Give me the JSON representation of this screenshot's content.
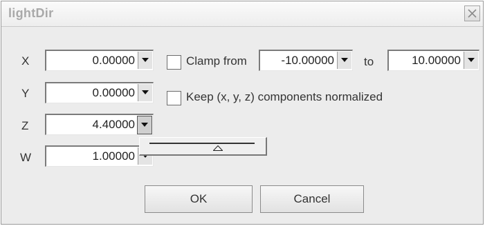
{
  "window": {
    "title": "lightDir",
    "close_icon": "close-x-icon"
  },
  "fields": [
    {
      "label": "X",
      "value": "0.00000"
    },
    {
      "label": "Y",
      "value": "0.00000"
    },
    {
      "label": "Z",
      "value": "4.40000"
    },
    {
      "label": "W",
      "value": "1.00000"
    }
  ],
  "clamp": {
    "label": "Clamp from",
    "min": "-10.00000",
    "to_label": "to",
    "max": "10.00000",
    "checked": false
  },
  "normalize": {
    "label": "Keep (x, y, z) components normalized",
    "checked": false
  },
  "slider_popup": {
    "level": 0.65
  },
  "buttons": {
    "ok": "OK",
    "cancel": "Cancel"
  }
}
